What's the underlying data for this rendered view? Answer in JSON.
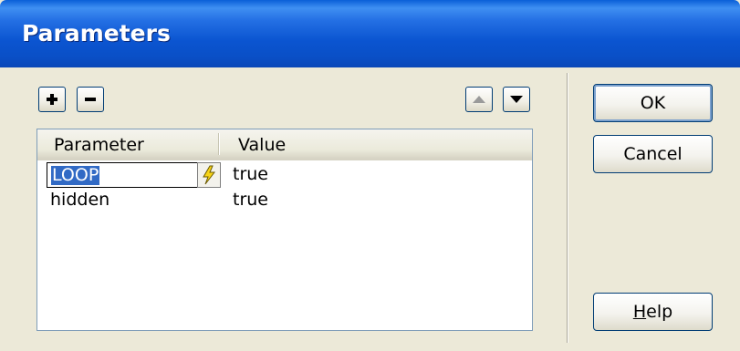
{
  "window": {
    "title": "Parameters"
  },
  "toolbar": {
    "add_icon": "plus-icon",
    "remove_icon": "minus-icon",
    "up_icon": "triangle-up-icon",
    "down_icon": "triangle-down-icon"
  },
  "table": {
    "columns": [
      "Parameter",
      "Value"
    ],
    "rows": [
      {
        "parameter": "LOOP",
        "value": "true"
      },
      {
        "parameter": "hidden",
        "value": "true"
      }
    ]
  },
  "buttons": {
    "ok": "OK",
    "cancel": "Cancel",
    "help_mnemonic": "H",
    "help_rest": "elp"
  }
}
